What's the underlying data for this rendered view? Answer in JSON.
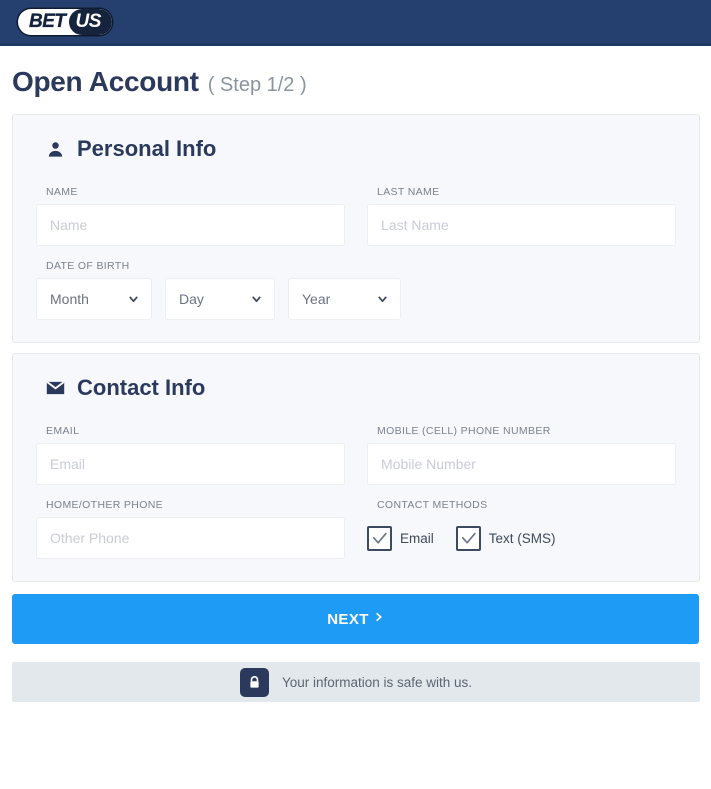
{
  "brand": {
    "logo_part1": "BET",
    "logo_part2": "US",
    "bar_color": "#25406f"
  },
  "header": {
    "title": "Open Account",
    "step": "( Step 1/2 )"
  },
  "sections": [
    {
      "id": "personal-info",
      "icon": "person-icon",
      "title": "Personal Info"
    },
    {
      "id": "contact-info",
      "icon": "envelope-icon",
      "title": "Contact Info"
    }
  ],
  "personal": {
    "name": {
      "label": "NAME",
      "placeholder": "Name",
      "value": ""
    },
    "last_name": {
      "label": "LAST NAME",
      "placeholder": "Last Name",
      "value": ""
    },
    "dob": {
      "label": "DATE OF BIRTH",
      "month": {
        "selected": "Month"
      },
      "day": {
        "selected": "Day"
      },
      "year": {
        "selected": "Year"
      }
    }
  },
  "contact": {
    "email": {
      "label": "EMAIL",
      "placeholder": "Email",
      "value": ""
    },
    "mobile": {
      "label": "MOBILE (CELL) PHONE NUMBER",
      "placeholder": "Mobile Number",
      "value": ""
    },
    "other_phone": {
      "label": "HOME/OTHER PHONE",
      "placeholder": "Other Phone",
      "value": ""
    },
    "methods": {
      "label": "CONTACT METHODS",
      "options": [
        {
          "label": "Email",
          "checked": true
        },
        {
          "label": "Text (SMS)",
          "checked": true
        }
      ]
    }
  },
  "actions": {
    "next_label": "NEXT",
    "next_arrow": "›",
    "next_color": "#1e9bf5"
  },
  "footer": {
    "icon": "lock-icon",
    "text": "Your information is safe with us."
  }
}
